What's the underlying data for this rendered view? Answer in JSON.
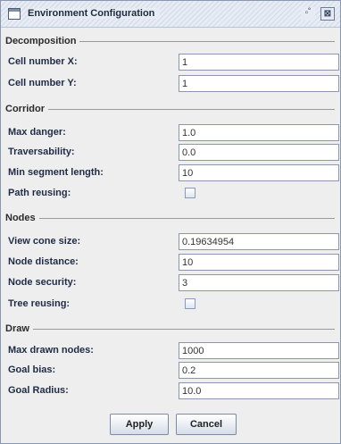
{
  "window": {
    "title": "Environment Configuration",
    "restore_glyph": "▫˚",
    "close_glyph": "⊠"
  },
  "groups": {
    "decomposition": {
      "title": "Decomposition",
      "rows": [
        {
          "label": "Cell number X:",
          "value": "1"
        },
        {
          "label": "Cell number Y:",
          "value": "1"
        }
      ]
    },
    "corridor": {
      "title": "Corridor",
      "rows": [
        {
          "label": "Max danger:",
          "value": "1.0"
        },
        {
          "label": "Traversability:",
          "value": "0.0"
        },
        {
          "label": "Min segment length:",
          "value": "10"
        },
        {
          "label": "Path reusing:",
          "checked": false
        }
      ]
    },
    "nodes": {
      "title": "Nodes",
      "rows": [
        {
          "label": "View cone size:",
          "value": "0.19634954"
        },
        {
          "label": "Node distance:",
          "value": "10"
        },
        {
          "label": "Node security:",
          "value": "3"
        },
        {
          "label": "Tree reusing:",
          "checked": false
        }
      ]
    },
    "draw": {
      "title": "Draw",
      "rows": [
        {
          "label": "Max drawn nodes:",
          "value": "1000"
        },
        {
          "label": "Goal bias:",
          "value": "0.2"
        },
        {
          "label": "Goal Radius:",
          "value": "10.0"
        }
      ]
    }
  },
  "buttons": {
    "apply": "Apply",
    "cancel": "Cancel"
  }
}
